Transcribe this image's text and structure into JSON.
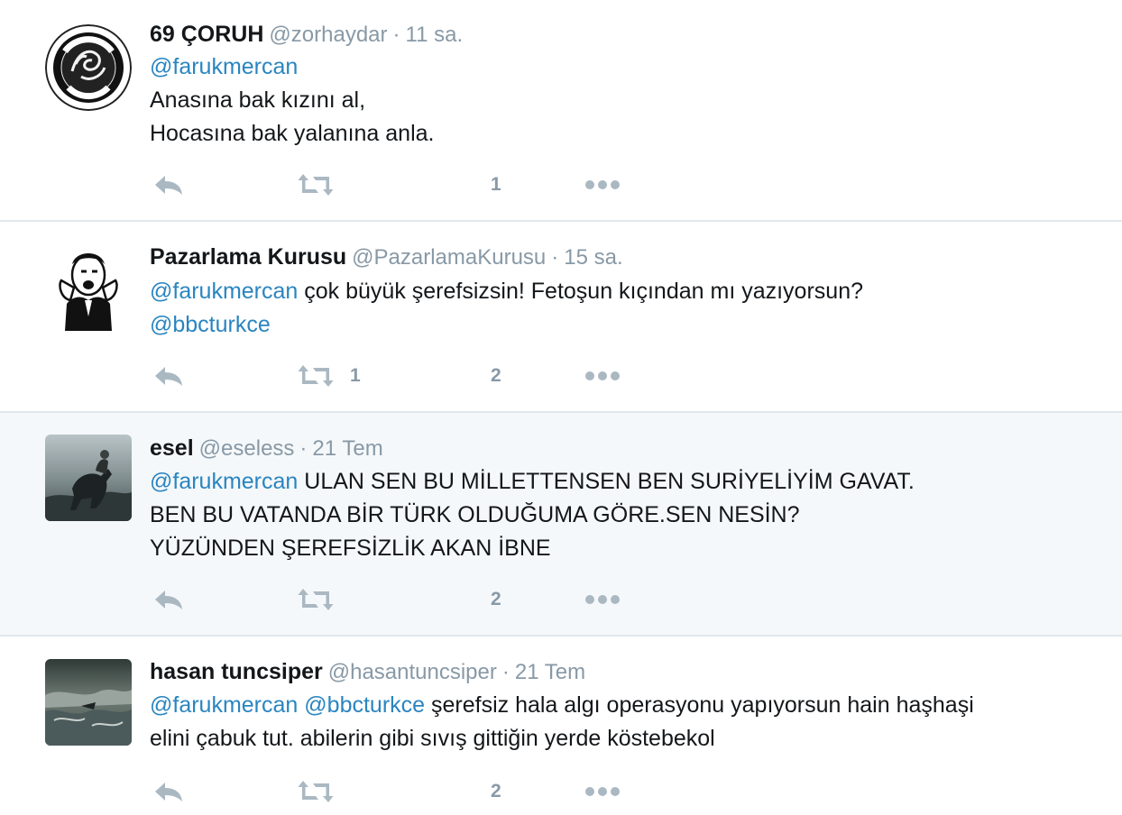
{
  "tweets": [
    {
      "name": "69 ÇORUH",
      "handle": "@zorhaydar",
      "separator": "·",
      "time": "11 sa.",
      "lines": [
        [
          {
            "text": "@farukmercan",
            "mention": true
          }
        ],
        [
          {
            "text": "Anasına bak kızını al,",
            "mention": false
          }
        ],
        [
          {
            "text": "Hocasına bak yalanına anla.",
            "mention": false
          }
        ]
      ],
      "retweet_count": "",
      "like_count": "1",
      "avatar": "osmanli-torunu-seal-icon",
      "highlighted": false
    },
    {
      "name": "Pazarlama Kurusu",
      "handle": "@PazarlamaKurusu",
      "separator": "·",
      "time": "15 sa.",
      "lines": [
        [
          {
            "text": "@farukmercan",
            "mention": true
          },
          {
            "text": " çok büyük şerefsizsin!  Fetoşun kıçından mı yazıyorsun?",
            "mention": false
          }
        ],
        [
          {
            "text": "@bbcturkce",
            "mention": true
          }
        ]
      ],
      "retweet_count": "1",
      "like_count": "2",
      "avatar": "shouting-man-sketch-icon",
      "highlighted": false
    },
    {
      "name": "esel",
      "handle": "@eseless",
      "separator": "·",
      "time": "21 Tem",
      "lines": [
        [
          {
            "text": "@farukmercan",
            "mention": true
          },
          {
            "text": " ULAN SEN BU MİLLETTENSEN BEN SURİYELİYİM GAVAT.",
            "mention": false
          }
        ],
        [
          {
            "text": "BEN BU VATANDA BİR TÜRK OLDUĞUMA GÖRE.SEN NESİN?",
            "mention": false
          }
        ],
        [
          {
            "text": "YÜZÜNDEN ŞEREFSİZLİK AKAN İBNE",
            "mention": false
          }
        ]
      ],
      "retweet_count": "",
      "like_count": "2",
      "avatar": "horseman-photo-icon",
      "highlighted": true
    },
    {
      "name": "hasan tuncsiper",
      "handle": "@hasantuncsiper",
      "separator": "·",
      "time": "21 Tem",
      "lines": [
        [
          {
            "text": "@farukmercan",
            "mention": true
          },
          {
            "text": " ",
            "mention": false
          },
          {
            "text": "@bbcturkce",
            "mention": true
          },
          {
            "text": " şerefsiz hala algı operasyonu yapıyorsun hain haşhaşi",
            "mention": false
          }
        ],
        [
          {
            "text": "elini çabuk tut. abilerin gibi sıvış gittiğin yerde köstebekol",
            "mention": false
          }
        ]
      ],
      "retweet_count": "",
      "like_count": "2",
      "avatar": "stormy-sea-photo-icon",
      "highlighted": false
    }
  ],
  "colors": {
    "mention": "#2a85c0",
    "meta": "#8899a6",
    "highlight_bg": "#f5f8fa",
    "divider": "#e1e8ed",
    "icon": "#aab8c2"
  }
}
